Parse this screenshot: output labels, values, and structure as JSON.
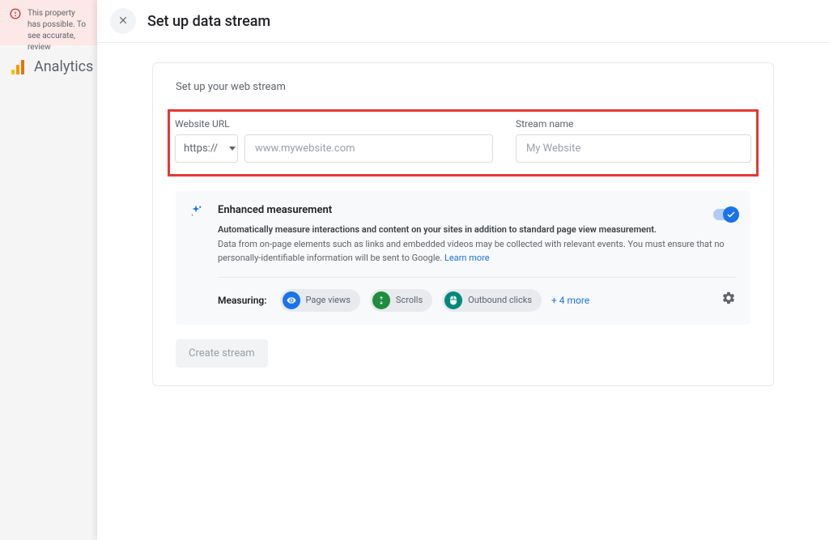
{
  "backdrop": {
    "alert_text": "This property has possible. To see accurate, review",
    "analytics_label": "Analytics"
  },
  "modal": {
    "title": "Set up data stream"
  },
  "card": {
    "subtitle": "Set up your web stream",
    "url_label": "Website URL",
    "protocol_value": "https://",
    "url_placeholder": "www.mywebsite.com",
    "stream_label": "Stream name",
    "stream_placeholder": "My Website"
  },
  "enhanced": {
    "title": "Enhanced measurement",
    "line1": "Automatically measure interactions and content on your sites in addition to standard page view measurement.",
    "line2": "Data from on-page elements such as links and embedded videos may be collected with relevant events. You must ensure that no personally-identifiable information will be sent to Google.",
    "learn_more": "Learn more"
  },
  "measuring": {
    "label": "Measuring:",
    "chip1": "Page views",
    "chip2": "Scrolls",
    "chip3": "Outbound clicks",
    "more": "+ 4 more"
  },
  "create_button": "Create stream"
}
